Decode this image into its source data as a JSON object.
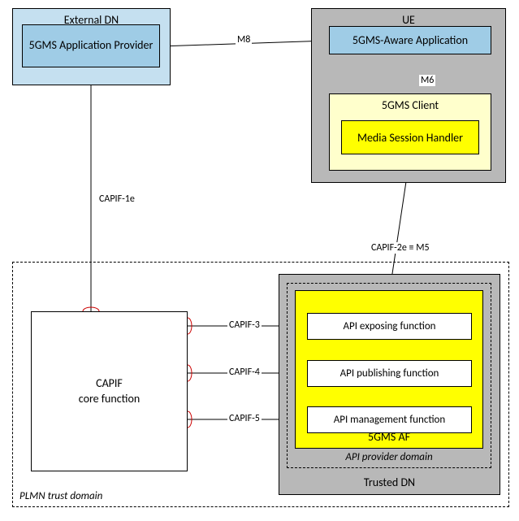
{
  "external_dn": {
    "label": "External DN",
    "provider": "5GMS Application Provider"
  },
  "ue": {
    "label": "UE",
    "aware_app": "5GMS-Aware Application",
    "client": "5GMS Client",
    "msh": "Media Session Handler"
  },
  "plmn": {
    "label": "PLMN trust domain"
  },
  "capif_core": "CAPIF\ncore function",
  "trusted_dn": {
    "label": "Trusted DN",
    "api_provider": "API provider domain",
    "af": "5GMS AF",
    "exposing": "API exposing function",
    "publishing": "API publishing function",
    "management": "API management function"
  },
  "interfaces": {
    "m8": "M8",
    "m6": "M6",
    "capif1e": "CAPIF-1e",
    "capif2e": "CAPIF-2e ≡ M5",
    "capif3": "CAPIF-3",
    "capif4": "CAPIF-4",
    "capif5": "CAPIF-5"
  }
}
